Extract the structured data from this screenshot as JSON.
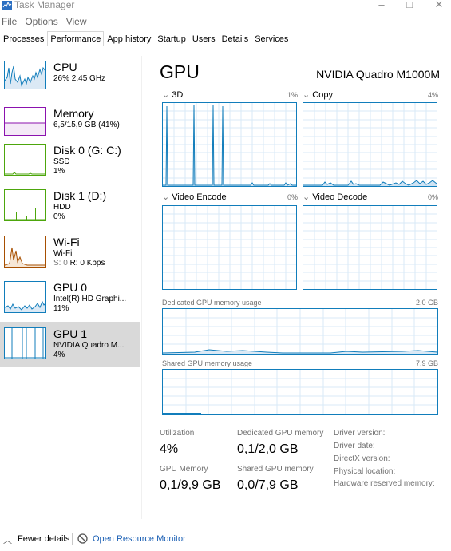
{
  "window": {
    "title": "Task Manager",
    "minimize": "–",
    "maximize": "□",
    "close": "✕"
  },
  "menu": [
    "File",
    "Options",
    "View"
  ],
  "tabs": [
    "Processes",
    "Performance",
    "App history",
    "Startup",
    "Users",
    "Details",
    "Services"
  ],
  "active_tab": "Performance",
  "sidebar": [
    {
      "name": "CPU",
      "line1": "26% 2,45 GHz",
      "color": "#117dbb"
    },
    {
      "name": "Memory",
      "line1": "6,5/15,9 GB (41%)",
      "color": "#8b12ae"
    },
    {
      "name": "Disk 0 (G: C:)",
      "line1": "SSD",
      "line2": "1%",
      "color": "#4da60c"
    },
    {
      "name": "Disk 1 (D:)",
      "line1": "HDD",
      "line2": "0%",
      "color": "#4da60c"
    },
    {
      "name": "Wi-Fi",
      "line1": "Wi-Fi",
      "line2_prefix": "S: 0 ",
      "line2_suffix": "R: 0 Kbps",
      "color": "#a74f01"
    },
    {
      "name": "GPU 0",
      "line1": "Intel(R) HD Graphi...",
      "line2": "11%",
      "color": "#117dbb"
    },
    {
      "name": "GPU 1",
      "line1": "NVIDIA Quadro M...",
      "line2": "4%",
      "color": "#117dbb"
    }
  ],
  "gpu": {
    "title": "GPU",
    "model": "NVIDIA Quadro M1000M",
    "engines": [
      {
        "name": "3D",
        "percent": "1%"
      },
      {
        "name": "Copy",
        "percent": "4%"
      },
      {
        "name": "Video Encode",
        "percent": "0%"
      },
      {
        "name": "Video Decode",
        "percent": "0%"
      }
    ],
    "dedicated_label": "Dedicated GPU memory usage",
    "dedicated_max": "2,0 GB",
    "shared_label": "Shared GPU memory usage",
    "shared_max": "7,9 GB",
    "stats": {
      "utilization_label": "Utilization",
      "utilization": "4%",
      "dedicated_label": "Dedicated GPU memory",
      "dedicated": "0,1/2,0 GB",
      "gpu_memory_label": "GPU Memory",
      "gpu_memory": "0,1/9,9 GB",
      "shared_label": "Shared GPU memory",
      "shared": "0,0/7,9 GB"
    },
    "info": [
      "Driver version:",
      "Driver date:",
      "DirectX version:",
      "Physical location:",
      "Hardware reserved memory:"
    ]
  },
  "footer": {
    "fewer": "Fewer details",
    "resource_monitor": "Open Resource Monitor"
  },
  "colors": {
    "gpu_blue": "#117dbb",
    "link": "#1a5fb4",
    "selected": "#d9d9d9"
  }
}
